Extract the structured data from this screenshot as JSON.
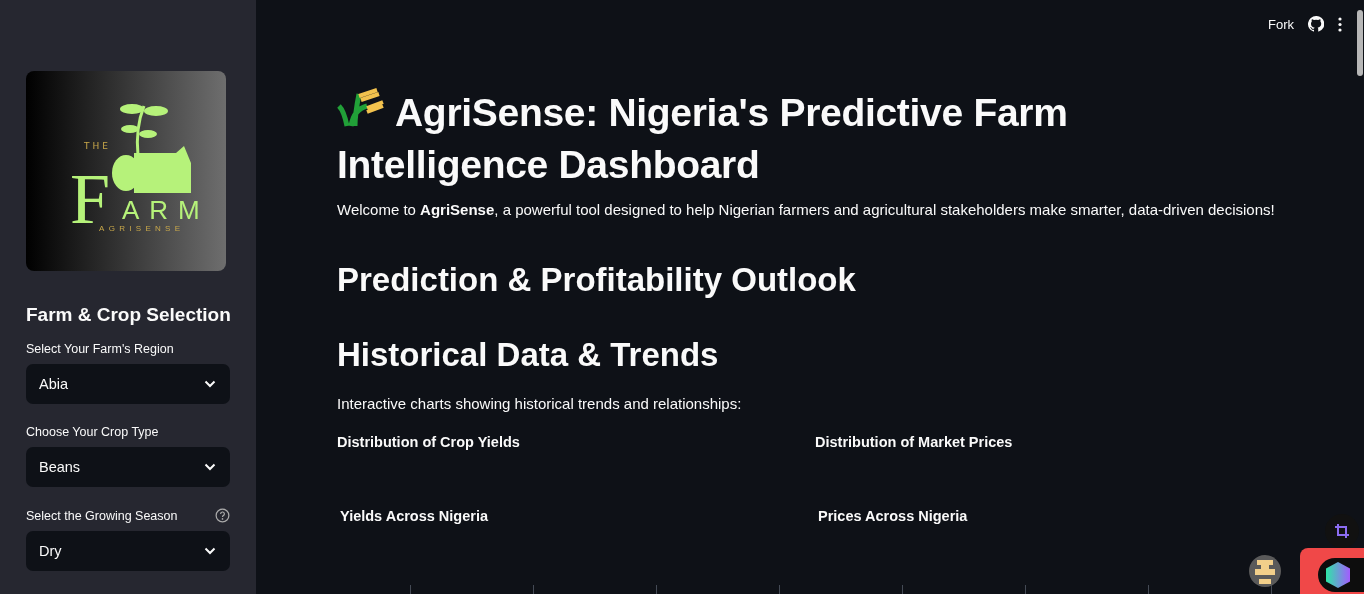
{
  "sidebar": {
    "logo": {
      "top": "THE",
      "letter": "F",
      "word": "ARM",
      "tagline": "AGRISENSE"
    },
    "heading": "Farm & Crop Selection",
    "fields": [
      {
        "label": "Select Your Farm's Region",
        "value": "Abia",
        "help": false
      },
      {
        "label": "Choose Your Crop Type",
        "value": "Beans",
        "help": false
      },
      {
        "label": "Select the Growing Season",
        "value": "Dry",
        "help": true
      }
    ]
  },
  "toolbar": {
    "fork": "Fork"
  },
  "main": {
    "title": "AgriSense: Nigeria's Predictive Farm Intelligence Dashboard",
    "intro": "Welcome to **AgriSense**, a powerful tool designed to help Nigerian farmers and agricultural stakeholders make smarter, data-driven decisions!",
    "sections": [
      {
        "heading": "Prediction & Profitability Outlook"
      },
      {
        "heading": "Historical Data & Trends",
        "text": "Interactive charts showing historical trends and relationships:"
      }
    ],
    "charts": [
      {
        "title": "Distribution of Crop Yields",
        "map_title": "Yields Across Nigeria"
      },
      {
        "title": "Distribution of Market Prices",
        "map_title": "Prices Across Nigeria"
      }
    ]
  }
}
